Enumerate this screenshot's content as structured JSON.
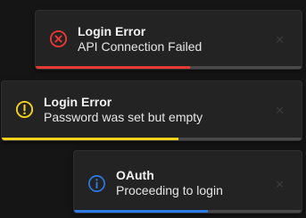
{
  "toasts": [
    {
      "title": "Login Error",
      "message": "API Connection Failed",
      "icon": "error-circle-x-icon",
      "color": "#e53935",
      "progress": 0.58,
      "close_glyph": "✕"
    },
    {
      "title": "Login Error",
      "message": "Password was set but empty",
      "icon": "warning-circle-exclamation-icon",
      "color": "#f2d21d",
      "progress": 0.59,
      "close_glyph": "✕"
    },
    {
      "title": "OAuth",
      "message": "Proceeding to login",
      "icon": "info-circle-icon",
      "color": "#2d7be5",
      "progress": 0.59,
      "close_glyph": "✕"
    }
  ]
}
